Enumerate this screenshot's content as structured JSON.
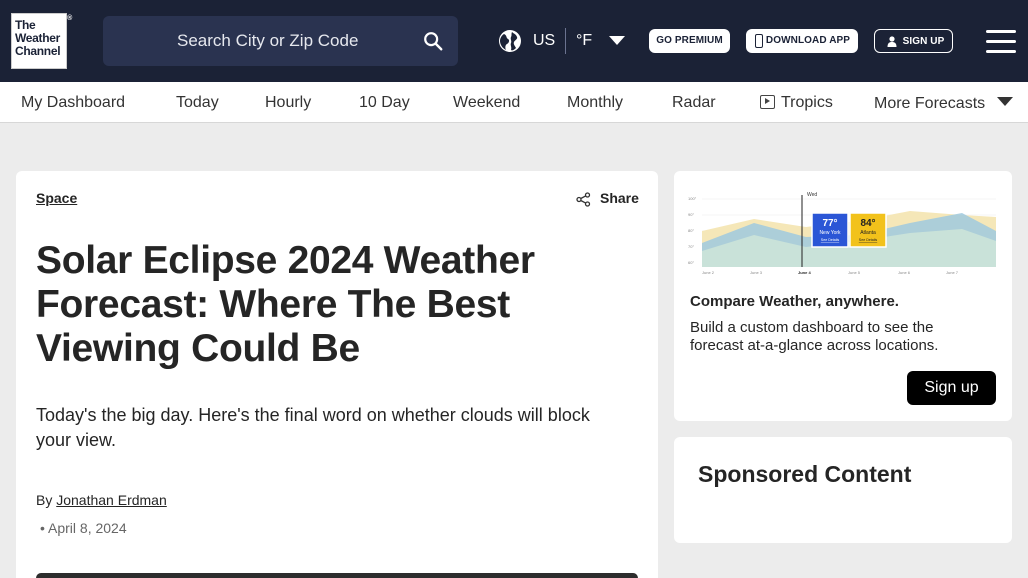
{
  "header": {
    "logo_lines": [
      "The",
      "Weather",
      "Channel"
    ],
    "logo_mark": "®",
    "search_placeholder": "Search City or Zip Code",
    "country": "US",
    "unit": "°F",
    "premium_label": "GO PREMIUM",
    "download_label": "DOWNLOAD APP",
    "signup_label": "SIGN UP",
    "colors": {
      "background": "#1b2236",
      "search_bg": "#2a3350"
    }
  },
  "nav": {
    "items": [
      "My Dashboard",
      "Today",
      "Hourly",
      "10 Day",
      "Weekend",
      "Monthly",
      "Radar",
      "Tropics",
      "More Forecasts"
    ]
  },
  "article": {
    "category": "Space",
    "share_label": "Share",
    "headline": "Solar Eclipse 2024 Weather Forecast: Where The Best Viewing Could Be",
    "dek": "Today's the big day. Here's the final word on whether clouds will block your view.",
    "by_label": "By",
    "author": "Jonathan Erdman",
    "date": "• April 8, 2024"
  },
  "promo": {
    "chart_day": "Wed",
    "chart_ticks": [
      "100°",
      "90°",
      "80°",
      "70°",
      "60°"
    ],
    "chart_dates": [
      "June 2",
      "June 3",
      "June 4",
      "June 5",
      "June 6",
      "June 7"
    ],
    "card_ny": {
      "temp": "77°",
      "city": "New York",
      "link": "See Details",
      "color": "#2b56d6"
    },
    "card_atl": {
      "temp": "84°",
      "city": "Atlanta",
      "link": "See Details",
      "color": "#f2c21b"
    },
    "title": "Compare Weather, anywhere.",
    "text": "Build a custom dashboard to see the forecast at-a-glance across locations.",
    "button_label": "Sign up"
  },
  "sponsored": {
    "title": "Sponsored Content"
  }
}
